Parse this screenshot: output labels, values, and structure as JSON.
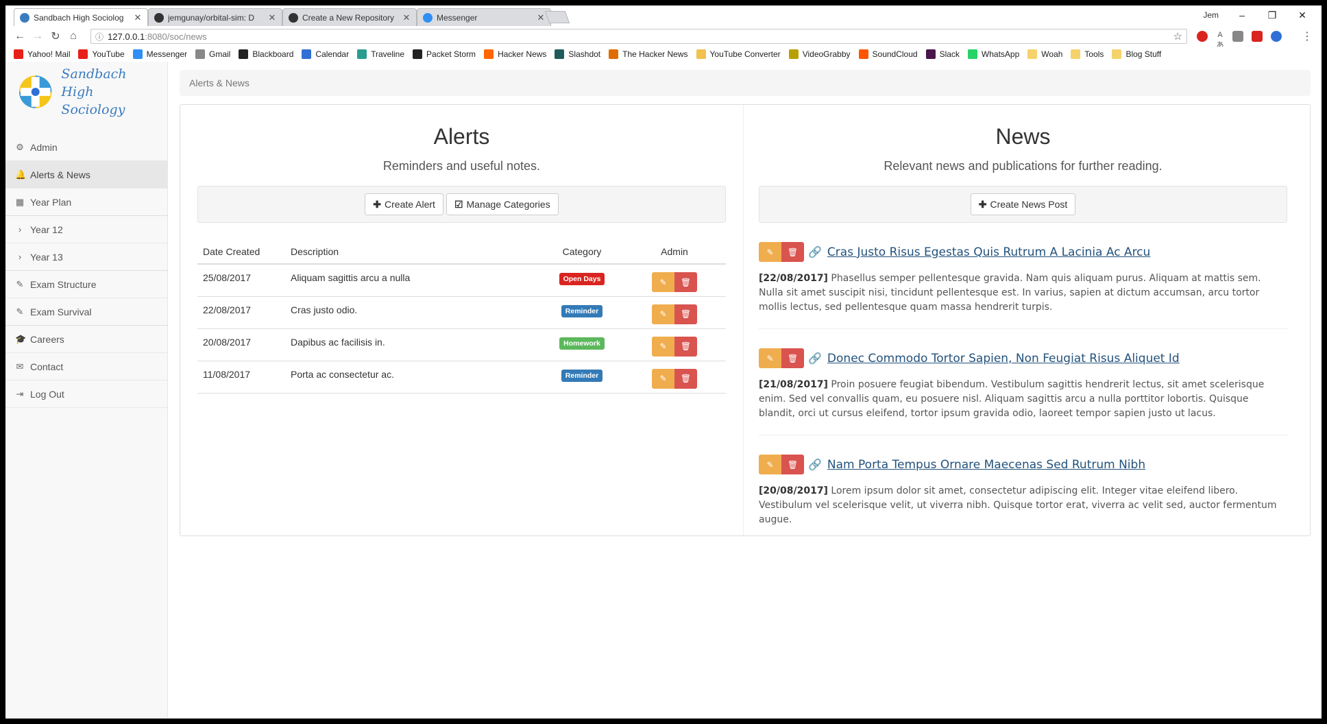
{
  "browser": {
    "tabs": [
      {
        "title": "Sandbach High Sociolog",
        "favicon": "#3a7bbf",
        "active": true
      },
      {
        "title": "jemgunay/orbital-sim: D",
        "favicon": "#333333",
        "active": false
      },
      {
        "title": "Create a New Repository",
        "favicon": "#333333",
        "active": false
      },
      {
        "title": "Messenger",
        "favicon": "#2f8ff5",
        "active": false
      }
    ],
    "user": "Jem",
    "url_host": "127.0.0.1",
    "url_path": ":8080/soc/news",
    "bookmarks": [
      {
        "label": "Yahoo! Mail",
        "color": "#e62117"
      },
      {
        "label": "YouTube",
        "color": "#e62117"
      },
      {
        "label": "Messenger",
        "color": "#2f8ff5"
      },
      {
        "label": "Gmail",
        "color": "#888888"
      },
      {
        "label": "Blackboard",
        "color": "#222222"
      },
      {
        "label": "Calendar",
        "color": "#2f6fd6"
      },
      {
        "label": "Traveline",
        "color": "#2a9d8f"
      },
      {
        "label": "Packet Storm",
        "color": "#222222"
      },
      {
        "label": "Hacker News",
        "color": "#ff6600"
      },
      {
        "label": "Slashdot",
        "color": "#1d5c5b"
      },
      {
        "label": "The Hacker News",
        "color": "#e06c00"
      },
      {
        "label": "YouTube Converter",
        "color": "#f2c14e"
      },
      {
        "label": "VideoGrabby",
        "color": "#b8a000"
      },
      {
        "label": "SoundCloud",
        "color": "#ff5500"
      },
      {
        "label": "Slack",
        "color": "#4a154b"
      },
      {
        "label": "WhatsApp",
        "color": "#25d366"
      },
      {
        "label": "Woah",
        "color": "#f5d26b"
      },
      {
        "label": "Tools",
        "color": "#f5d26b"
      },
      {
        "label": "Blog Stuff",
        "color": "#f5d26b"
      }
    ]
  },
  "site": {
    "title_line1": "Sandbach High",
    "title_line2": "Sociology"
  },
  "sidebar": {
    "items": [
      {
        "label": "Admin",
        "icon": "gear-icon",
        "glyph": "⚙",
        "active": false
      },
      {
        "label": "Alerts & News",
        "icon": "bell-icon",
        "glyph": "🔔",
        "active": true
      },
      {
        "label": "Year Plan",
        "icon": "calendar-icon",
        "glyph": "▦",
        "active": false
      },
      {
        "label": "Year 12",
        "icon": "chevron-right-icon",
        "glyph": "›",
        "active": false
      },
      {
        "label": "Year 13",
        "icon": "chevron-right-icon",
        "glyph": "›",
        "active": false
      },
      {
        "label": "Exam Structure",
        "icon": "pencil-icon",
        "glyph": "✎",
        "active": false
      },
      {
        "label": "Exam Survival",
        "icon": "pencil-icon",
        "glyph": "✎",
        "active": false
      },
      {
        "label": "Careers",
        "icon": "graduation-cap-icon",
        "glyph": "🎓",
        "active": false
      },
      {
        "label": "Contact",
        "icon": "envelope-icon",
        "glyph": "✉",
        "active": false
      },
      {
        "label": "Log Out",
        "icon": "logout-icon",
        "glyph": "⇥",
        "active": false
      }
    ]
  },
  "breadcrumb": "Alerts & News",
  "alerts": {
    "title": "Alerts",
    "subtitle": "Reminders and useful notes.",
    "create_label": "Create Alert",
    "manage_label": "Manage Categories",
    "headers": {
      "date": "Date Created",
      "description": "Description",
      "category": "Category",
      "admin": "Admin"
    },
    "rows": [
      {
        "date": "25/08/2017",
        "description": "Aliquam sagittis arcu a nulla",
        "category": "Open Days",
        "color": "#d9241f"
      },
      {
        "date": "22/08/2017",
        "description": "Cras justo odio.",
        "category": "Reminder",
        "color": "#337ab7"
      },
      {
        "date": "20/08/2017",
        "description": "Dapibus ac facilisis in.",
        "category": "Homework",
        "color": "#5cb85c"
      },
      {
        "date": "11/08/2017",
        "description": "Porta ac consectetur ac.",
        "category": "Reminder",
        "color": "#337ab7"
      }
    ]
  },
  "news": {
    "title": "News",
    "subtitle": "Relevant news and publications for further reading.",
    "create_label": "Create News Post",
    "posts": [
      {
        "title": "Cras Justo Risus Egestas Quis Rutrum A Lacinia Ac Arcu",
        "date": "[22/08/2017]",
        "body": "Phasellus semper pellentesque gravida. Nam quis aliquam purus. Aliquam at mattis sem. Nulla sit amet suscipit nisi, tincidunt pellentesque est. In varius, sapien at dictum accumsan, arcu tortor mollis lectus, sed pellentesque quam massa hendrerit turpis."
      },
      {
        "title": "Donec Commodo Tortor Sapien, Non Feugiat Risus Aliquet Id",
        "date": "[21/08/2017]",
        "body": "Proin posuere feugiat bibendum. Vestibulum sagittis hendrerit lectus, sit amet scelerisque enim. Sed vel convallis quam, eu posuere nisl. Aliquam sagittis arcu a nulla porttitor lobortis. Quisque blandit, orci ut cursus eleifend, tortor ipsum gravida odio, laoreet tempor sapien justo ut lacus."
      },
      {
        "title": "Nam Porta Tempus Ornare Maecenas Sed Rutrum Nibh",
        "date": "[20/08/2017]",
        "body": "Lorem ipsum dolor sit amet, consectetur adipiscing elit. Integer vitae eleifend libero. Vestibulum vel scelerisque velit, ut viverra nibh. Quisque tortor erat, viverra ac velit sed, auctor fermentum augue."
      }
    ]
  }
}
